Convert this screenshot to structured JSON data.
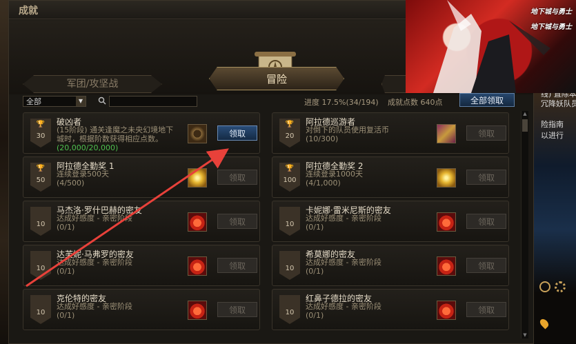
{
  "window": {
    "title": "成就"
  },
  "banner": {
    "logo_lines": [
      "地下城与勇士",
      "地下城与勇士"
    ]
  },
  "tabs": {
    "left": "军团/攻坚战",
    "main": "冒险"
  },
  "toolbar": {
    "filter_value": "全部",
    "search_value": "",
    "progress_text": "进度  17.5%(34/194)",
    "points_text": "成就点数 640点",
    "claim_all_label": "全部领取"
  },
  "achievements": [
    {
      "title": "破凶者",
      "desc_lines": [
        "(15阶段) 通关逢魔之未央幻境地下",
        "城时，根据阶数获得相应点数。"
      ],
      "progress": "(20,000/20,000)",
      "points": "30",
      "cup_color": "#c9c9c9",
      "reward_icon": "emblem-icon",
      "claim": "领取",
      "active": true
    },
    {
      "title": "阿拉德巡游者",
      "desc_lines": [
        "对倒下的队员使用复活币"
      ],
      "progress": "(10/300)",
      "points": "20",
      "cup_color": "#c9c9c9",
      "reward_icon": "box-icon",
      "claim": "领取",
      "active": false
    },
    {
      "title": "阿拉德全勤奖 1",
      "desc_lines": [
        "连续登录500天"
      ],
      "progress": "(4/500)",
      "points": "50",
      "cup_color": "#e6b530",
      "reward_icon": "star-icon",
      "claim": "领取",
      "active": false
    },
    {
      "title": "阿拉德全勤奖 2",
      "desc_lines": [
        "连续登录1000天"
      ],
      "progress": "(4/1,000)",
      "points": "100",
      "cup_color": "#9d86d6",
      "reward_icon": "star-icon",
      "claim": "领取",
      "active": false
    },
    {
      "title": "马杰洛·罗什巴赫的密友",
      "desc_lines": [
        "达成好感度 - 亲密阶段"
      ],
      "progress": "(0/1)",
      "points": "10",
      "cup_color": "",
      "reward_icon": "heart-icon",
      "claim": "领取",
      "active": false
    },
    {
      "title": "卡妮娜·雷米尼斯的密友",
      "desc_lines": [
        "达成好感度 - 亲密阶段"
      ],
      "progress": "(0/1)",
      "points": "10",
      "cup_color": "",
      "reward_icon": "heart-icon",
      "claim": "领取",
      "active": false
    },
    {
      "title": "达芙妮·马弗罗的密友",
      "desc_lines": [
        "达成好感度 - 亲密阶段"
      ],
      "progress": "(0/1)",
      "points": "10",
      "cup_color": "",
      "reward_icon": "heart-icon",
      "claim": "领取",
      "active": false
    },
    {
      "title": "希莫娜的密友",
      "desc_lines": [
        "达成好感度 - 亲密阶段"
      ],
      "progress": "(0/1)",
      "points": "10",
      "cup_color": "",
      "reward_icon": "heart-icon",
      "claim": "领取",
      "active": false
    },
    {
      "title": "克伦特的密友",
      "desc_lines": [
        "达成好感度 - 亲密阶段"
      ],
      "progress": "(0/1)",
      "points": "10",
      "cup_color": "",
      "reward_icon": "heart-icon",
      "claim": "领取",
      "active": false
    },
    {
      "title": "红鼻子德拉的密友",
      "desc_lines": [
        "达成好感度 - 亲密阶段"
      ],
      "progress": "(0/1)",
      "points": "10",
      "cup_color": "",
      "reward_icon": "heart-icon",
      "claim": "领取",
      "active": false
    }
  ],
  "side_panel": {
    "lines": [
      "线) 直除本",
      "冗降妖队员",
      "险指南",
      "以进行"
    ]
  },
  "colors": {
    "accent_blue": "#2a4d78",
    "highlight_green": "#4fc04f",
    "annotation_red": "#e8413a"
  }
}
